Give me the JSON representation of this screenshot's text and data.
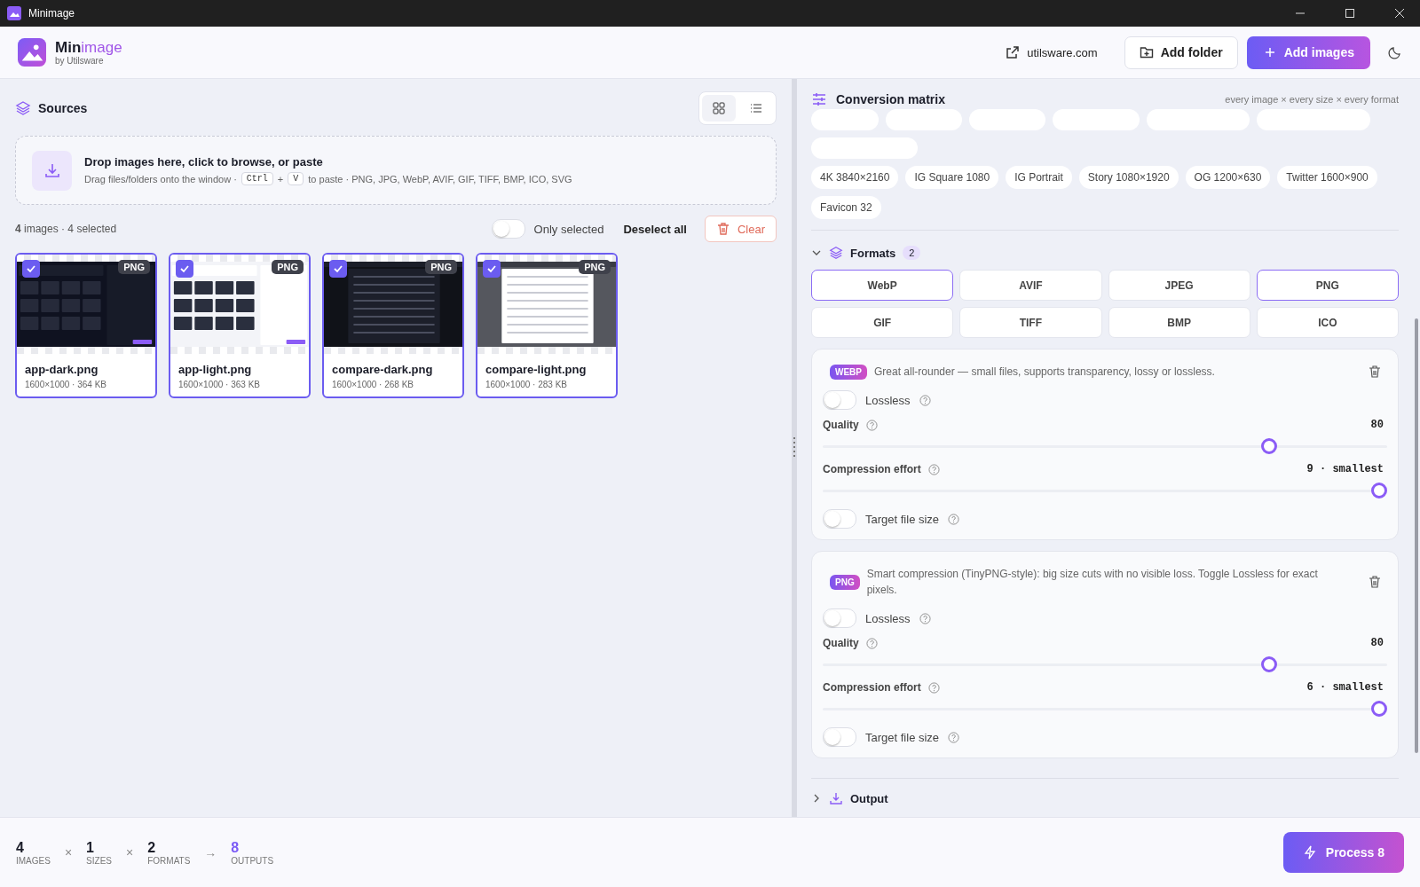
{
  "window": {
    "title": "Minimage"
  },
  "brand": {
    "name_start": "Min",
    "name_end": "image",
    "tagline": "by Utilsware"
  },
  "header": {
    "link": "utilsware.com",
    "buttons": [
      {
        "label": "Add folder",
        "kind": "secondary"
      },
      {
        "label": "Add images",
        "kind": "primary"
      }
    ]
  },
  "sources": {
    "title": "Sources",
    "views": [
      {
        "kind": "grid",
        "selected": true
      },
      {
        "kind": "list",
        "selected": false
      }
    ],
    "dropzone": {
      "title": "Drop images here, click to browse, or paste",
      "hint_before": "Drag files/folders onto the window ·",
      "keys": [
        "Ctrl",
        "V"
      ],
      "plus": "+",
      "hint_after": "to paste · PNG, JPG, WebP, AVIF, GIF, TIFF, BMP, ICO, SVG"
    },
    "summary": "**4** images · 4 selected",
    "only_selected": {
      "label": "Only selected",
      "on": false
    },
    "deselect": "Deselect all",
    "clear": "Clear",
    "images": [
      {
        "name": "app-dark.png",
        "meta": "1600×1000 · 364 KB",
        "format": "PNG",
        "checked": true,
        "kind": "picture"
      },
      {
        "name": "app-light.png",
        "meta": "1600×1000 · 363 KB",
        "format": "PNG",
        "checked": true,
        "kind": "picture"
      },
      {
        "name": "compare-dark.png",
        "meta": "1600×1000 · 268 KB",
        "format": "PNG",
        "checked": true,
        "kind": "picture"
      },
      {
        "name": "compare-light.png",
        "meta": "1600×1000 · 283 KB",
        "format": "PNG",
        "checked": true,
        "kind": "picture"
      }
    ]
  },
  "matrix": {
    "title": "Conversion matrix",
    "note": "every image × every size × every format",
    "sizes": [
      "4K 3840×2160",
      "IG Square 1080",
      "IG Portrait",
      "Story 1080×1920",
      "OG 1200×630",
      "Twitter 1600×900",
      "Favicon 32"
    ]
  },
  "formats": {
    "title": "Formats",
    "count": "2",
    "expanded": true,
    "options": [
      {
        "label": "WebP",
        "selected": true
      },
      {
        "label": "AVIF",
        "selected": false
      },
      {
        "label": "JPEG",
        "selected": false
      },
      {
        "label": "PNG",
        "selected": true
      },
      {
        "label": "GIF",
        "selected": false
      },
      {
        "label": "TIFF",
        "selected": false
      },
      {
        "label": "BMP",
        "selected": false
      },
      {
        "label": "ICO",
        "selected": false
      }
    ]
  },
  "settings": [
    {
      "badge": "WEBP",
      "description": "Great all-rounder — small files, supports transparency, lossy or lossless.",
      "lossless": {
        "label": "Lossless",
        "on": false
      },
      "quality": {
        "label": "Quality",
        "reading": "80",
        "level": 0.8
      },
      "effort": {
        "label": "Compression effort",
        "reading": "9 · smallest",
        "level": 1
      },
      "target": {
        "label": "Target file size",
        "on": false
      }
    },
    {
      "badge": "PNG",
      "description": "Smart compression (TinyPNG-style): big size cuts with no visible loss. Toggle Lossless for exact pixels.",
      "lossless": {
        "label": "Lossless",
        "on": false
      },
      "quality": {
        "label": "Quality",
        "reading": "80",
        "level": 0.8
      },
      "effort": {
        "label": "Compression effort",
        "reading": "6 · smallest",
        "level": 1
      },
      "target": {
        "label": "Target file size",
        "on": false
      }
    }
  ],
  "output": {
    "title": "Output",
    "expanded": false
  },
  "footer": {
    "stats": [
      {
        "value": "4",
        "label": "IMAGES",
        "op": "×",
        "highlight": false
      },
      {
        "value": "1",
        "label": "SIZES",
        "op": "×",
        "highlight": false
      },
      {
        "value": "2",
        "label": "FORMATS",
        "op": "→",
        "highlight": false
      },
      {
        "value": "8",
        "label": "OUTPUTS",
        "highlight": true
      }
    ],
    "process": "Process 8"
  }
}
